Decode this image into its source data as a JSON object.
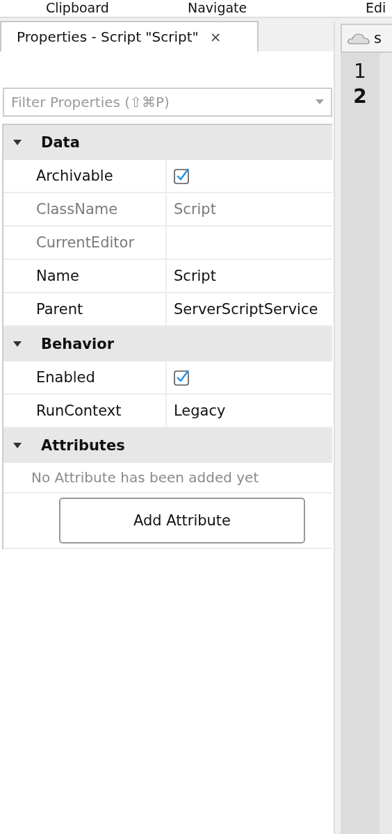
{
  "ribbon": {
    "groups": [
      "Clipboard",
      "Navigate",
      "Edi"
    ]
  },
  "tabs": [
    {
      "label": "Properties - Script \"Script\"",
      "selected": true,
      "close": "×"
    },
    {
      "label": "s",
      "selected": false
    }
  ],
  "filter": {
    "placeholder": "Filter Properties (⇧⌘P)"
  },
  "sections": [
    {
      "title": "Data",
      "expanded": true,
      "properties": [
        {
          "name": "Archivable",
          "kind": "checkbox",
          "checked": true,
          "disabled": false
        },
        {
          "name": "ClassName",
          "kind": "text",
          "value": "Script",
          "disabled": true
        },
        {
          "name": "CurrentEditor",
          "kind": "text",
          "disabled": true
        },
        {
          "name": "Name",
          "kind": "text",
          "value": "Script",
          "disabled": false
        },
        {
          "name": "Parent",
          "kind": "text",
          "value": "ServerScriptService",
          "disabled": false
        }
      ]
    },
    {
      "title": "Behavior",
      "expanded": true,
      "properties": [
        {
          "name": "Enabled",
          "kind": "checkbox",
          "checked": true,
          "disabled": false
        },
        {
          "name": "RunContext",
          "kind": "text",
          "value": "Legacy",
          "disabled": false
        }
      ]
    },
    {
      "title": "Attributes",
      "expanded": true,
      "empty_note": "No Attribute has been added yet",
      "button": "Add Attribute"
    }
  ],
  "editor": {
    "line_numbers": [
      {
        "number": "1",
        "current": false
      },
      {
        "number": "2",
        "current": true
      }
    ]
  }
}
